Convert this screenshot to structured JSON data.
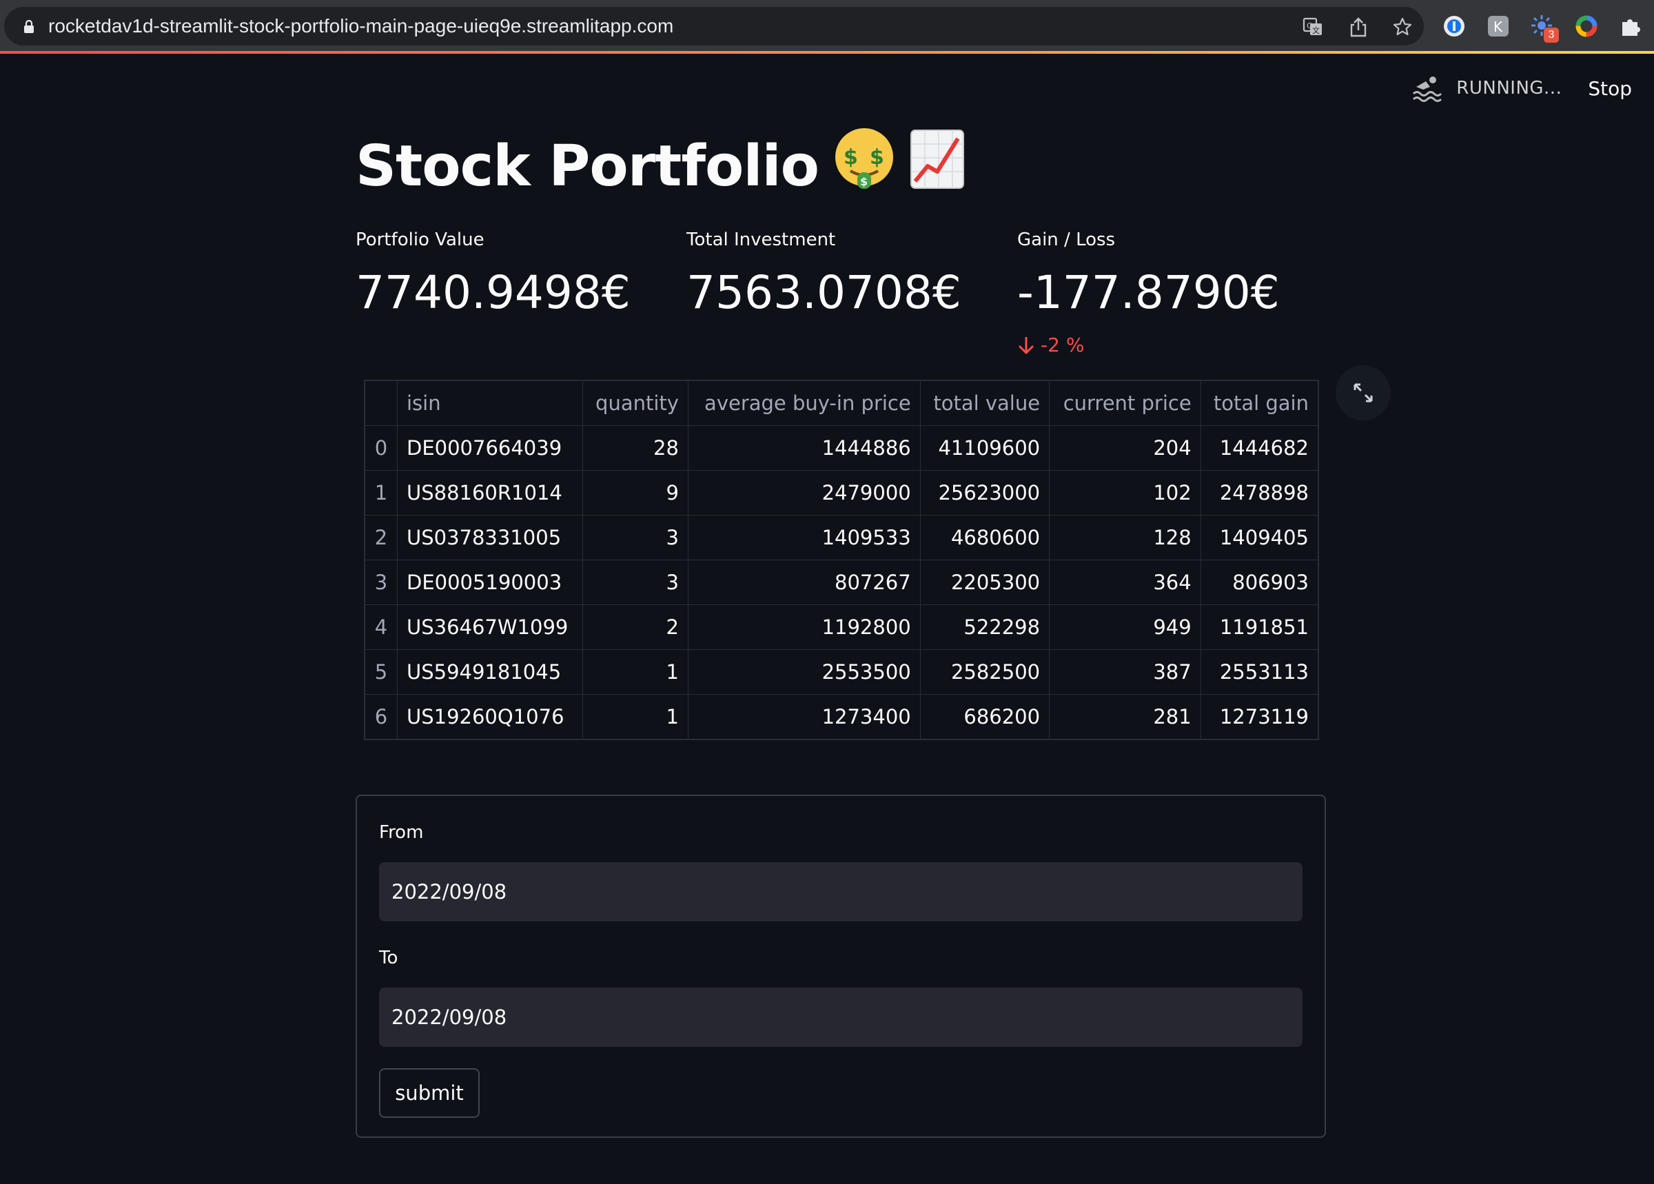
{
  "browser": {
    "url": "rocketdav1d-streamlit-stock-portfolio-main-page-uieq9e.streamlitapp.com",
    "extension_badge": "3",
    "icons": [
      "lock-icon",
      "translate-icon",
      "share-icon",
      "bookmark-star-icon",
      "password-manager-icon",
      "keyboard-extension-icon",
      "puzzle-badge-extension-icon",
      "color-wheel-icon",
      "extensions-puzzle-icon"
    ]
  },
  "app_status": {
    "running_text": "RUNNING...",
    "stop_label": "Stop"
  },
  "page": {
    "title": "Stock Portfolio",
    "title_emojis": [
      "🤑",
      "📈"
    ]
  },
  "metrics": [
    {
      "label": "Portfolio Value",
      "value": "7740.9498€"
    },
    {
      "label": "Total Investment",
      "value": "7563.0708€"
    },
    {
      "label": "Gain / Loss",
      "value": "-177.8790€",
      "delta": "-2 %",
      "delta_direction": "down",
      "delta_color": "#ff4b4b"
    }
  ],
  "table": {
    "columns": [
      "",
      "isin",
      "quantity",
      "average buy-in price",
      "total value",
      "current price",
      "total gain"
    ],
    "rows": [
      [
        "0",
        "DE0007664039",
        "28",
        "1444886",
        "41109600",
        "204",
        "1444682"
      ],
      [
        "1",
        "US88160R1014",
        "9",
        "2479000",
        "25623000",
        "102",
        "2478898"
      ],
      [
        "2",
        "US0378331005",
        "3",
        "1409533",
        "4680600",
        "128",
        "1409405"
      ],
      [
        "3",
        "DE0005190003",
        "3",
        "807267",
        "2205300",
        "364",
        "806903"
      ],
      [
        "4",
        "US36467W1099",
        "2",
        "1192800",
        "522298",
        "949",
        "1191851"
      ],
      [
        "5",
        "US5949181045",
        "1",
        "2553500",
        "2582500",
        "387",
        "2553113"
      ],
      [
        "6",
        "US19260Q1076",
        "1",
        "1273400",
        "686200",
        "281",
        "1273119"
      ]
    ]
  },
  "form": {
    "from_label": "From",
    "from_value": "2022/09/08",
    "to_label": "To",
    "to_value": "2022/09/08",
    "submit_label": "submit"
  },
  "colors": {
    "background": "#0e1117",
    "input_background": "#262730",
    "negative": "#ff4b4b",
    "text": "#fafafa"
  }
}
